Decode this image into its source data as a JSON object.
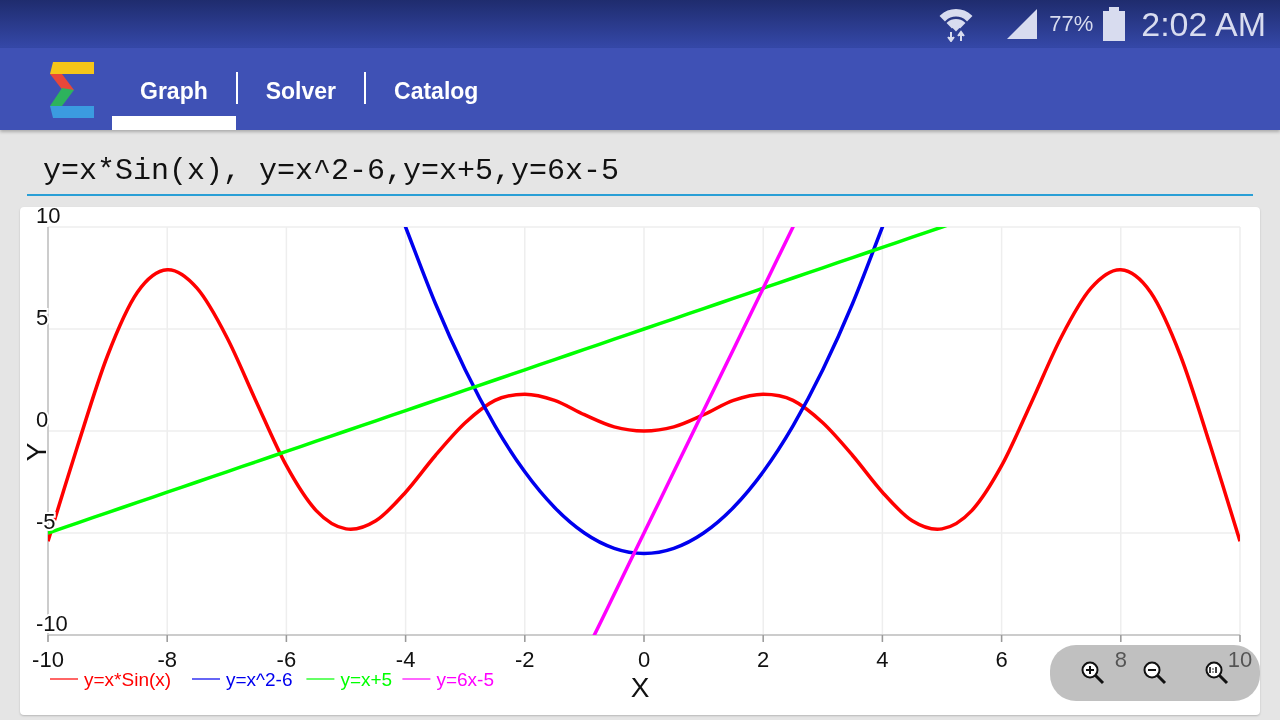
{
  "status_bar": {
    "battery_percent": "77%",
    "time": "2:02 AM"
  },
  "app_bar": {
    "tabs": [
      {
        "label": "Graph",
        "selected": true
      },
      {
        "label": "Solver",
        "selected": false
      },
      {
        "label": "Catalog",
        "selected": false
      }
    ]
  },
  "expression_field": {
    "value": "y=x*Sin(x), y=x^2-6,y=x+5,y=6x-5"
  },
  "graph": {
    "chart_data": {
      "type": "line",
      "xlabel": "X",
      "ylabel": "Y",
      "grid": true,
      "legend": "bottom-left",
      "xlim": [
        -10,
        10
      ],
      "ylim": [
        -10,
        10
      ],
      "xticks": [
        -10,
        -8,
        -6,
        -4,
        -2,
        0,
        2,
        4,
        6,
        8,
        10
      ],
      "yticks": [
        -10,
        -5,
        0,
        5,
        10
      ],
      "x": [
        -10,
        -9.5,
        -9,
        -8.5,
        -8,
        -7.5,
        -7,
        -6.5,
        -6,
        -5.5,
        -5,
        -4.5,
        -4,
        -3.5,
        -3,
        -2.5,
        -2,
        -1.5,
        -1,
        -0.5,
        0,
        0.5,
        1,
        1.5,
        2,
        2.5,
        3,
        3.5,
        4,
        4.5,
        5,
        5.5,
        6,
        6.5,
        7,
        7.5,
        8,
        8.5,
        9,
        9.5,
        10
      ],
      "series": [
        {
          "name": "y=x*Sin(x)",
          "color": "#ff0000",
          "values": [
            -5.4,
            -0.7,
            3.7,
            6.8,
            7.9,
            7.0,
            4.6,
            1.4,
            -1.7,
            -3.9,
            -4.8,
            -4.4,
            -3.0,
            -1.2,
            0.4,
            1.5,
            1.8,
            1.5,
            0.8,
            0.2,
            0,
            0.2,
            0.8,
            1.5,
            1.8,
            1.5,
            0.4,
            -1.2,
            -3.0,
            -4.4,
            -4.8,
            -3.9,
            -1.7,
            1.4,
            4.6,
            7.0,
            7.9,
            6.8,
            3.7,
            -0.7,
            -5.4
          ]
        },
        {
          "name": "y=x^2-6",
          "color": "#0000ee",
          "values": [
            null,
            null,
            null,
            null,
            null,
            null,
            null,
            null,
            null,
            null,
            null,
            null,
            10,
            6.25,
            3,
            0.25,
            -2,
            -3.75,
            -5,
            -5.75,
            -6,
            -5.75,
            -5,
            -3.75,
            -2,
            0.25,
            3,
            6.25,
            10,
            null,
            null,
            null,
            null,
            null,
            null,
            null,
            null,
            null,
            null,
            null,
            null
          ]
        },
        {
          "name": "y=x+5",
          "color": "#00ff00",
          "values": [
            -5,
            -4.5,
            -4,
            -3.5,
            -3,
            -2.5,
            -2,
            -1.5,
            -1,
            -0.5,
            0,
            0.5,
            1,
            1.5,
            2,
            2.5,
            3,
            3.5,
            4,
            4.5,
            5,
            5.5,
            6,
            6.5,
            7,
            7.5,
            8,
            8.5,
            9,
            9.5,
            10,
            null,
            null,
            null,
            null,
            null,
            null,
            null,
            null,
            null,
            null
          ]
        },
        {
          "name": "y=6x-5",
          "color": "#ff00ff",
          "values": [
            null,
            null,
            null,
            null,
            null,
            null,
            null,
            null,
            null,
            null,
            null,
            null,
            null,
            null,
            null,
            null,
            null,
            null,
            null,
            -8,
            -5,
            -2,
            1,
            4,
            7,
            10,
            null,
            null,
            null,
            null,
            null,
            null,
            null,
            null,
            null,
            null,
            null,
            null,
            null,
            null,
            null
          ]
        }
      ]
    }
  }
}
